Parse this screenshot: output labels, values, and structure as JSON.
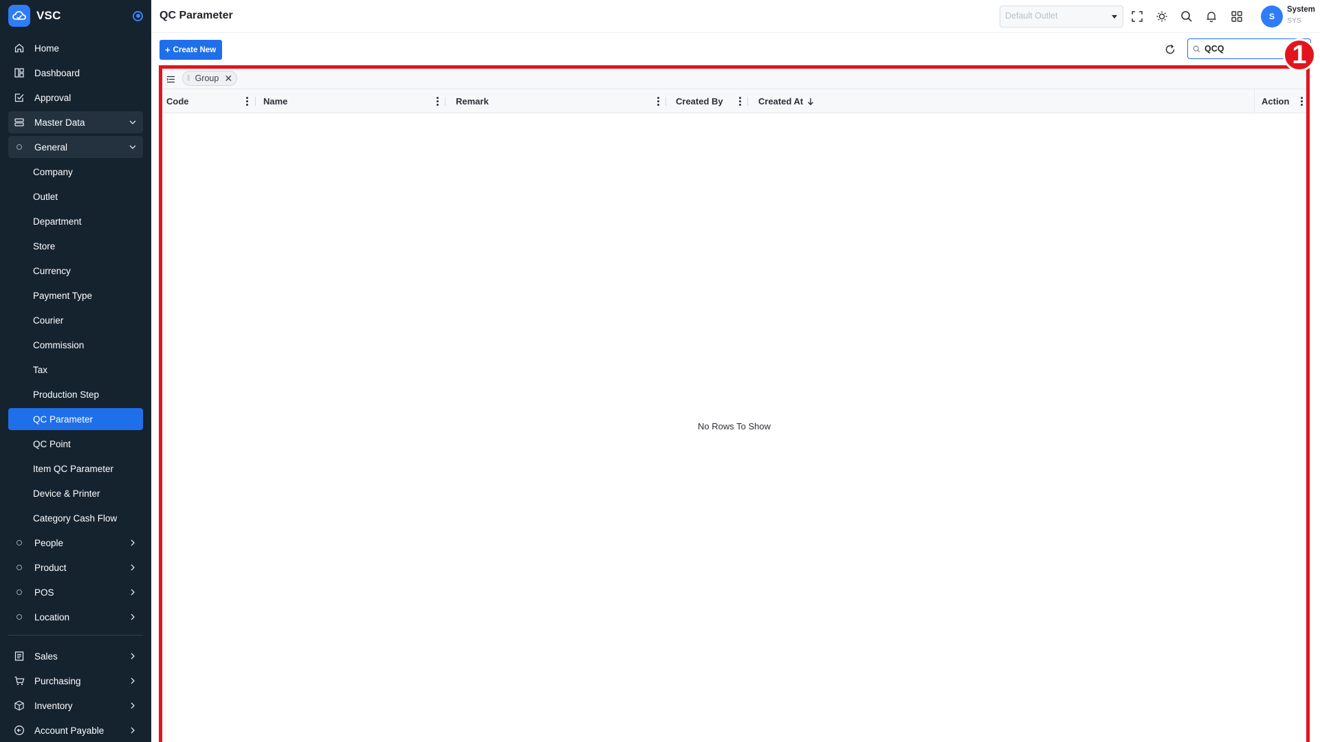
{
  "app": {
    "name": "VSC"
  },
  "sidebar": {
    "top_items": [
      {
        "label": "Home",
        "icon": "home-icon"
      },
      {
        "label": "Dashboard",
        "icon": "dashboard-icon"
      },
      {
        "label": "Approval",
        "icon": "approval-icon"
      }
    ],
    "master_data": {
      "label": "Master Data",
      "icon": "database-icon",
      "expanded": true
    },
    "general": {
      "label": "General",
      "expanded": true
    },
    "general_items": [
      "Company",
      "Outlet",
      "Department",
      "Store",
      "Currency",
      "Payment Type",
      "Courier",
      "Commission",
      "Tax",
      "Production Step",
      "QC Parameter",
      "QC Point",
      "Item QC Parameter",
      "Device & Printer",
      "Category Cash Flow"
    ],
    "active_item": "QC Parameter",
    "collapsed_groups": [
      "People",
      "Product",
      "POS",
      "Location"
    ],
    "bottom_items": [
      {
        "label": "Sales",
        "icon": "sales-icon"
      },
      {
        "label": "Purchasing",
        "icon": "cart-icon"
      },
      {
        "label": "Inventory",
        "icon": "box-icon"
      },
      {
        "label": "Account Payable",
        "icon": "payable-icon"
      }
    ]
  },
  "header": {
    "title": "QC Parameter",
    "outlet_placeholder": "Default Outlet",
    "user": {
      "initial": "S",
      "name": "System",
      "code": "SYS"
    }
  },
  "toolbar": {
    "create_label": "Create New",
    "search_value": "QCQ"
  },
  "grid": {
    "group_chip": "Group",
    "columns": [
      "Code",
      "Name",
      "Remark",
      "Created By",
      "Created At",
      "Action"
    ],
    "sorted_column": "Created At",
    "sort_direction": "desc",
    "empty_message": "No Rows To Show"
  },
  "annotation": {
    "badge": "1",
    "color": "#e3141d"
  },
  "colors": {
    "sidebar_bg": "#15232f",
    "accent": "#1f6feb",
    "highlight": "#e3141d"
  }
}
